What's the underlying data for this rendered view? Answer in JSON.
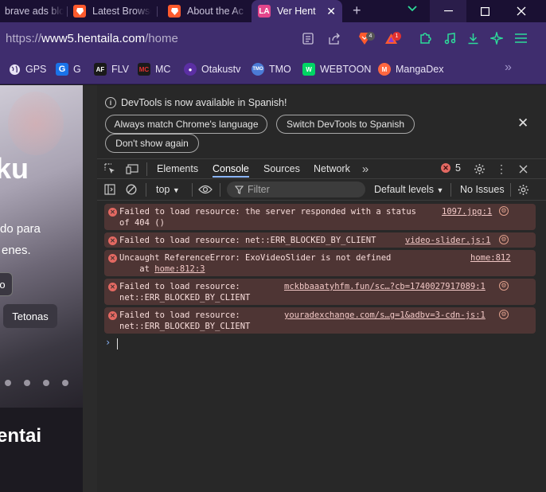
{
  "browser": {
    "tabs": [
      {
        "title": "brave ads blo",
        "icon": "brave-icon"
      },
      {
        "title": "Latest Browse",
        "icon": "brave-lion-icon"
      },
      {
        "title": "About the Ac",
        "icon": "brave-lion-icon"
      },
      {
        "title": "Ver Hent",
        "icon": "hentaila-icon",
        "active": true
      }
    ],
    "new_tab": "+",
    "url": {
      "prefix": "https://",
      "host": "www5.hentaila.com",
      "path": "/home"
    },
    "shield_badge": "4",
    "rewards_badge": "1",
    "bookmarks": [
      {
        "label": "GPS",
        "icon": "globe-icon",
        "color": "#3f2d6e"
      },
      {
        "label": "G",
        "icon": "G",
        "color": "#1a73e8"
      },
      {
        "label": "FLV",
        "icon": "AF",
        "color": "#1a1a1a"
      },
      {
        "label": "MC",
        "icon": "MC",
        "color": "#1a1a1a"
      },
      {
        "label": "Otakustv",
        "icon": "otakustv-icon",
        "color": "#5b2fa3"
      },
      {
        "label": "TMO",
        "icon": "tmo-icon",
        "color": "#4b7bd6"
      },
      {
        "label": "WEBTOON",
        "icon": "webtoon-icon",
        "color": "#00d564"
      },
      {
        "label": "MangaDex",
        "icon": "mangadex-icon",
        "color": "#ff6740"
      }
    ]
  },
  "page": {
    "hero_title": "ku",
    "hero_line1": "do para",
    "hero_line2": "enes.",
    "hero_button_fragment": "o",
    "tag_button": "Tetonas",
    "section_title": "entai"
  },
  "devtools": {
    "notice": {
      "text": "DevTools is now available in Spanish!",
      "btn_match": "Always match Chrome's language",
      "btn_switch": "Switch DevTools to Spanish",
      "btn_dont_show": "Don't show again"
    },
    "tabs": [
      "Elements",
      "Console",
      "Sources",
      "Network"
    ],
    "active_tab": "Console",
    "error_count": "5",
    "context": "top",
    "filter_placeholder": "Filter",
    "levels": "Default levels",
    "issues": "No Issues",
    "logs": [
      {
        "line1": "Failed to load resource: the server responded with a status",
        "line2": "of 404 ()",
        "source": "1097.jpg:1"
      },
      {
        "line1": "Failed to load resource: net::ERR_BLOCKED_BY_CLIENT",
        "source": "video-slider.js:1"
      },
      {
        "line1": "Uncaught ReferenceError: ExoVideoSlider is not defined",
        "line2_prefix": "    at ",
        "line2_link": "home:812:3",
        "source": "home:812"
      },
      {
        "line1": "Failed to load resource:",
        "line2": "net::ERR_BLOCKED_BY_CLIENT",
        "source": "mckbbaaatyhfm.fun/sc…?cb=1740027917089:1"
      },
      {
        "line1": "Failed to load resource:",
        "line2": "net::ERR_BLOCKED_BY_CLIENT",
        "source": "youradexchange.com/s…g=1&adbv=3-cdn-js:1"
      }
    ],
    "prompt": "›"
  },
  "colors": {
    "accent": "#3f2d6e",
    "error_bg": "#4e3534",
    "error_icon": "#e46962",
    "active_tab_underline": "#8ab4f8"
  }
}
